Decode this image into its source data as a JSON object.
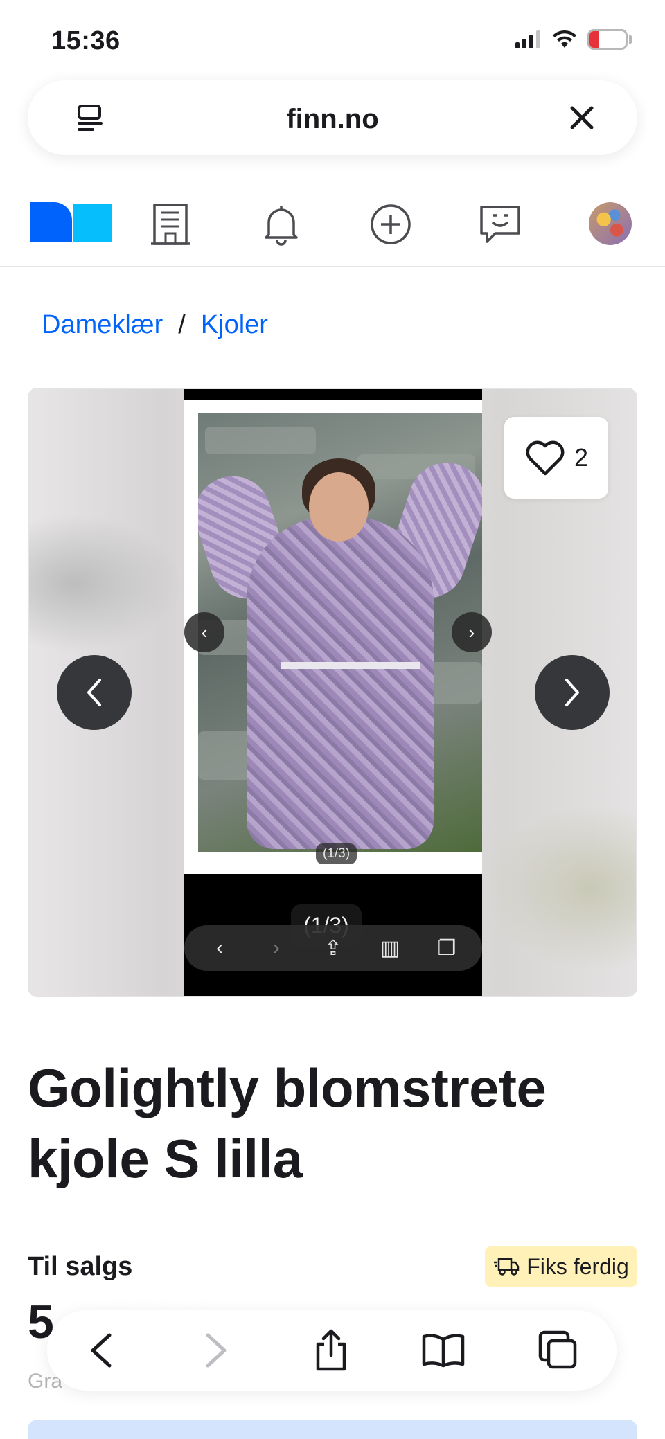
{
  "status_bar": {
    "time": "15:36",
    "battery": "13"
  },
  "browser": {
    "address": "finn.no"
  },
  "site_nav": {
    "items": [
      "logo",
      "building-icon",
      "bell-icon",
      "plus-circle-icon",
      "chat-icon",
      "avatar"
    ]
  },
  "breadcrumb": {
    "items": [
      "Dameklær",
      "Kjoler"
    ],
    "separator": "/"
  },
  "gallery": {
    "favorites_count": "2",
    "image_counter_small": "(1/3)",
    "image_counter": "(1/3)"
  },
  "listing": {
    "title": "Golightly blomstrete kjole S lilla",
    "status": "Til salgs",
    "badge": "Fiks ferdig",
    "price_partial": "5",
    "sub_partial": "Gra"
  },
  "colors": {
    "link": "#0063fb",
    "badge_bg": "#fff1b8",
    "logo_dark": "#0063fb",
    "logo_light": "#06befb"
  }
}
